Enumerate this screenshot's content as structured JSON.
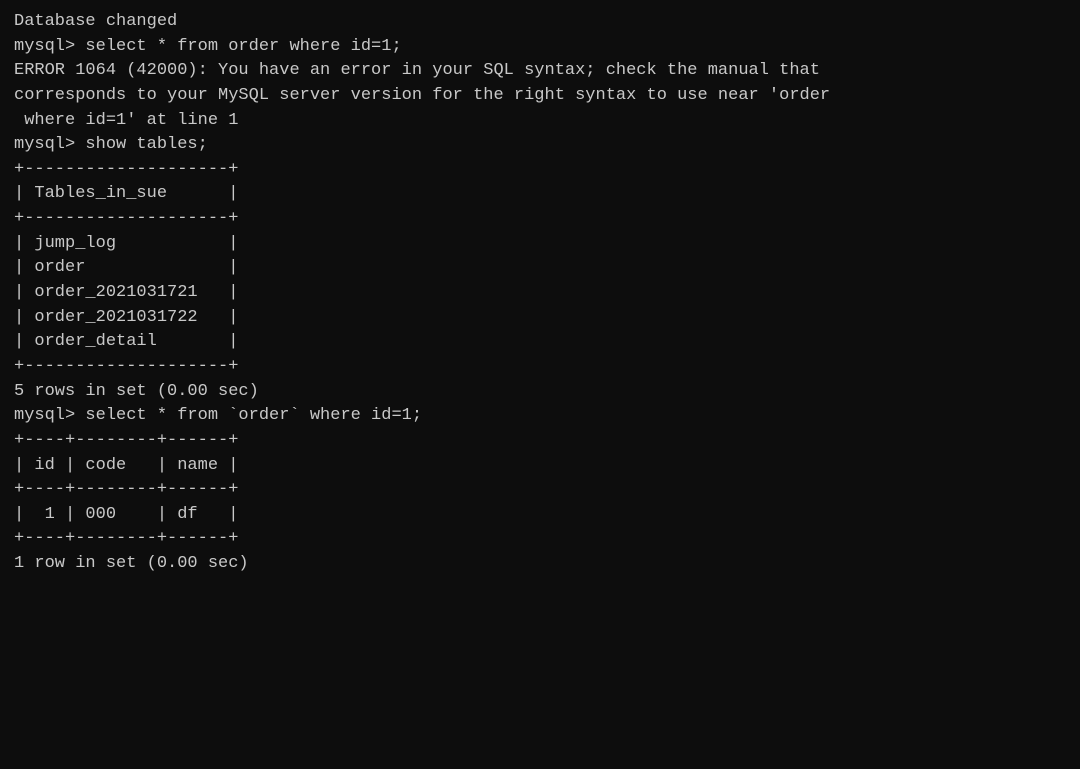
{
  "terminal": {
    "background": "#0d0d0d",
    "text_color": "#c8c8c8",
    "lines": [
      {
        "type": "normal",
        "text": "Database changed"
      },
      {
        "type": "prompt",
        "text": "mysql> select * from order where id=1;"
      },
      {
        "type": "error",
        "text": "ERROR 1064 (42000): You have an error in your SQL syntax; check the manual that"
      },
      {
        "type": "error",
        "text": "corresponds to your MySQL server version for the right syntax to use near 'order"
      },
      {
        "type": "error",
        "text": " where id=1' at line 1"
      },
      {
        "type": "prompt",
        "text": "mysql> show tables;"
      },
      {
        "type": "table",
        "text": "+--------------------+"
      },
      {
        "type": "table",
        "text": "| Tables_in_sue      |"
      },
      {
        "type": "table",
        "text": "+--------------------+"
      },
      {
        "type": "table",
        "text": "| jump_log           |"
      },
      {
        "type": "table",
        "text": "| order              |"
      },
      {
        "type": "table",
        "text": "| order_2021031721   |"
      },
      {
        "type": "table",
        "text": "| order_2021031722   |"
      },
      {
        "type": "table",
        "text": "| order_detail       |"
      },
      {
        "type": "table",
        "text": "+--------------------+"
      },
      {
        "type": "normal",
        "text": "5 rows in set (0.00 sec)"
      },
      {
        "type": "normal",
        "text": ""
      },
      {
        "type": "prompt",
        "text": "mysql> select * from `order` where id=1;"
      },
      {
        "type": "table",
        "text": "+----+--------+------+"
      },
      {
        "type": "table",
        "text": "| id | code   | name |"
      },
      {
        "type": "table",
        "text": "+----+--------+------+"
      },
      {
        "type": "table",
        "text": "|  1 | 000    | df   |"
      },
      {
        "type": "table",
        "text": "+----+--------+------+"
      },
      {
        "type": "normal",
        "text": "1 row in set (0.00 sec)"
      }
    ]
  }
}
